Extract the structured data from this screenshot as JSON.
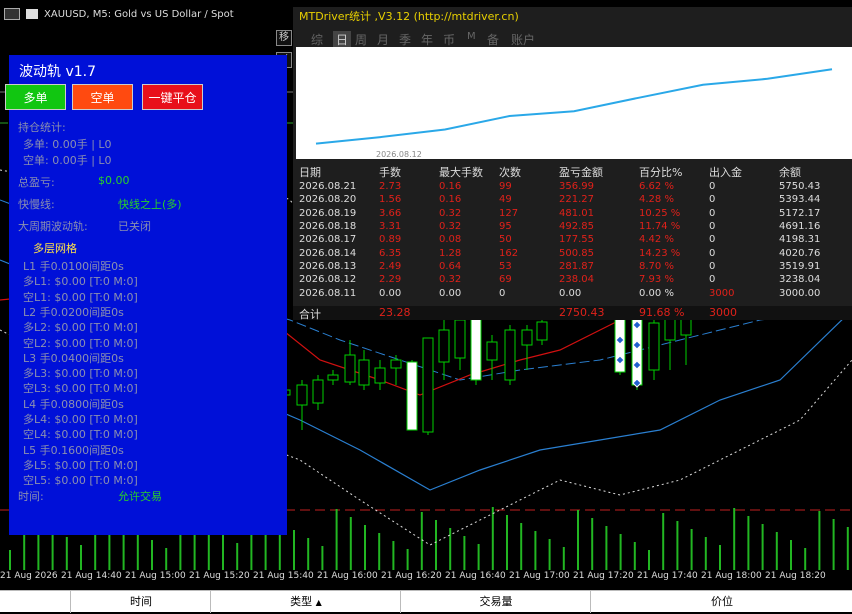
{
  "chart_window": {
    "title": "XAUUSD, M5:  Gold vs US Dollar / Spot",
    "time_labels": [
      "21 Aug 2026",
      "21 Aug 14:40",
      "21 Aug 15:00",
      "21 Aug 15:20",
      "21 Aug 15:40",
      "21 Aug 16:00",
      "21 Aug 16:20",
      "21 Aug 16:40",
      "21 Aug 17:00",
      "21 Aug 17:20",
      "21 Aug 17:40",
      "21 Aug 18:00",
      "21 Aug 18:20"
    ],
    "side_buttons": [
      "移",
      "√"
    ],
    "colors": {
      "bull_candle": "#ffffff",
      "bear_candle": "#00d000",
      "ma_red": "#d01010",
      "band_blue": "#2a7fd0",
      "volume": "#22b722"
    }
  },
  "panel": {
    "title": "波动轨 v1.7",
    "buttons": {
      "long": "多单",
      "short": "空单",
      "close_all": "一键平仓"
    },
    "position_header": "持仓统计:",
    "long_pos": "多单: 0.00手 | L0",
    "short_pos": "空单: 0.00手 | L0",
    "pnl_label": "总盈亏:",
    "pnl_value": "$0.00",
    "fast_slow_label": "快慢线:",
    "fast_slow_value": "快线之上(多)",
    "big_cycle_label": "大周期波动轨:",
    "big_cycle_value": "已关闭",
    "grid_header": "多层网格",
    "grid_lines": [
      "L1 手0.0100间距0s",
      "多L1: $0.00 [T:0 M:0]",
      "空L1: $0.00 [T:0 M:0]",
      "L2 手0.0200间距0s",
      "多L2: $0.00 [T:0 M:0]",
      "空L2: $0.00 [T:0 M:0]",
      "L3 手0.0400间距0s",
      "多L3: $0.00 [T:0 M:0]",
      "空L3: $0.00 [T:0 M:0]",
      "L4 手0.0800间距0s",
      "多L4: $0.00 [T:0 M:0]",
      "空L4: $0.00 [T:0 M:0]",
      "L5 手0.1600间距0s",
      "多L5: $0.00 [T:0 M:0]",
      "空L5: $0.00 [T:0 M:0]"
    ],
    "time_label": "时间:",
    "time_value": "允许交易"
  },
  "mtdriver": {
    "title": "MTDriver统计 ,V3.12 (http://mtdriver.cn)",
    "tabs": [
      "综",
      "日",
      "周",
      "月",
      "季",
      "年",
      "币",
      "M",
      "备",
      "账户"
    ],
    "active_tab": "日",
    "equity_date": "2026.08.12",
    "equity_curve": [
      3000.0,
      3238.04,
      3519.91,
      4020.76,
      4198.31,
      4691.16,
      5172.17,
      5393.44,
      5750.43
    ],
    "columns": [
      "日期",
      "手数",
      "最大手数",
      "次数",
      "盈亏金额",
      "百分比%",
      "出入金",
      "余额"
    ],
    "rows": [
      [
        "2026.08.21",
        "2.73",
        "0.16",
        "99",
        "356.99",
        "6.62 %",
        "0",
        "5750.43"
      ],
      [
        "2026.08.20",
        "1.56",
        "0.16",
        "49",
        "221.27",
        "4.28 %",
        "0",
        "5393.44"
      ],
      [
        "2026.08.19",
        "3.66",
        "0.32",
        "127",
        "481.01",
        "10.25 %",
        "0",
        "5172.17"
      ],
      [
        "2026.08.18",
        "3.31",
        "0.32",
        "95",
        "492.85",
        "11.74 %",
        "0",
        "4691.16"
      ],
      [
        "2026.08.17",
        "0.89",
        "0.08",
        "50",
        "177.55",
        "4.42 %",
        "0",
        "4198.31"
      ],
      [
        "2026.08.14",
        "6.35",
        "1.28",
        "162",
        "500.85",
        "14.23 %",
        "0",
        "4020.76"
      ],
      [
        "2026.08.13",
        "2.49",
        "0.64",
        "53",
        "281.87",
        "8.70 %",
        "0",
        "3519.91"
      ],
      [
        "2026.08.12",
        "2.29",
        "0.32",
        "69",
        "238.04",
        "7.93 %",
        "0",
        "3238.04"
      ],
      [
        "2026.08.11",
        "0.00",
        "0.00",
        "0",
        "0.00",
        "0.00 %",
        "3000",
        "3000.00"
      ]
    ],
    "total": {
      "label": "合计",
      "lots": "23.28",
      "pnl": "2750.43",
      "pct": "91.68 %",
      "deposit": "3000"
    }
  },
  "bottom_bar": {
    "columns": [
      "时间",
      "类型",
      "交易量",
      "价位"
    ]
  }
}
